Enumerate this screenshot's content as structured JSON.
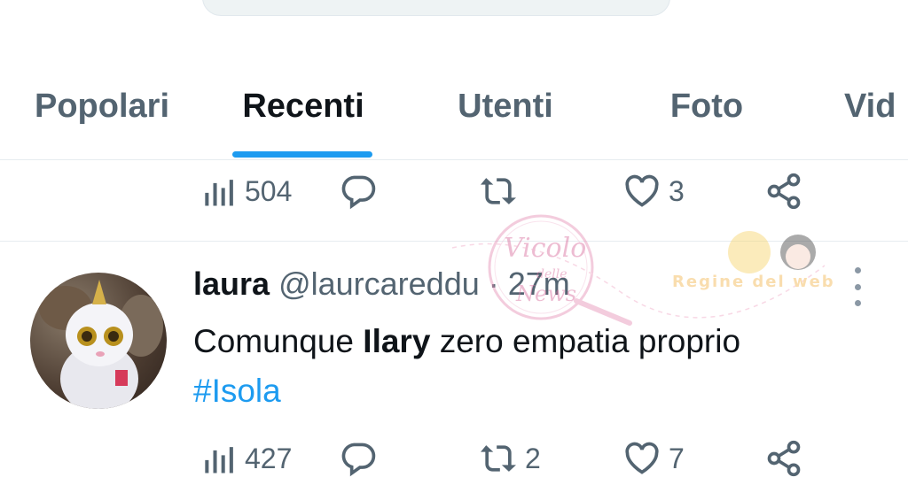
{
  "tabs": [
    {
      "label": "Popolari"
    },
    {
      "label": "Recenti"
    },
    {
      "label": "Utenti"
    },
    {
      "label": "Foto"
    },
    {
      "label": "Vid"
    }
  ],
  "active_tab": "Recenti",
  "prev_tweet_actions": {
    "views": "504",
    "replies": "",
    "retweets": "",
    "likes": "3"
  },
  "tweet": {
    "name": "laura",
    "handle": "@laurcareddu",
    "separator": "·",
    "time": "27m",
    "text_before": "Comunque ",
    "text_bold": "Ilary",
    "text_after": " zero empatia proprio",
    "hashtag": "#Isola"
  },
  "next_tweet_actions": {
    "views": "427",
    "retweets": "2",
    "likes": "7"
  },
  "watermark": {
    "text1": "Vicolo",
    "text2": "delle",
    "text3": "News",
    "text4": "Regine del web"
  },
  "colors": {
    "accent": "#1d9bf0",
    "muted": "#536471",
    "text": "#0f1419"
  }
}
